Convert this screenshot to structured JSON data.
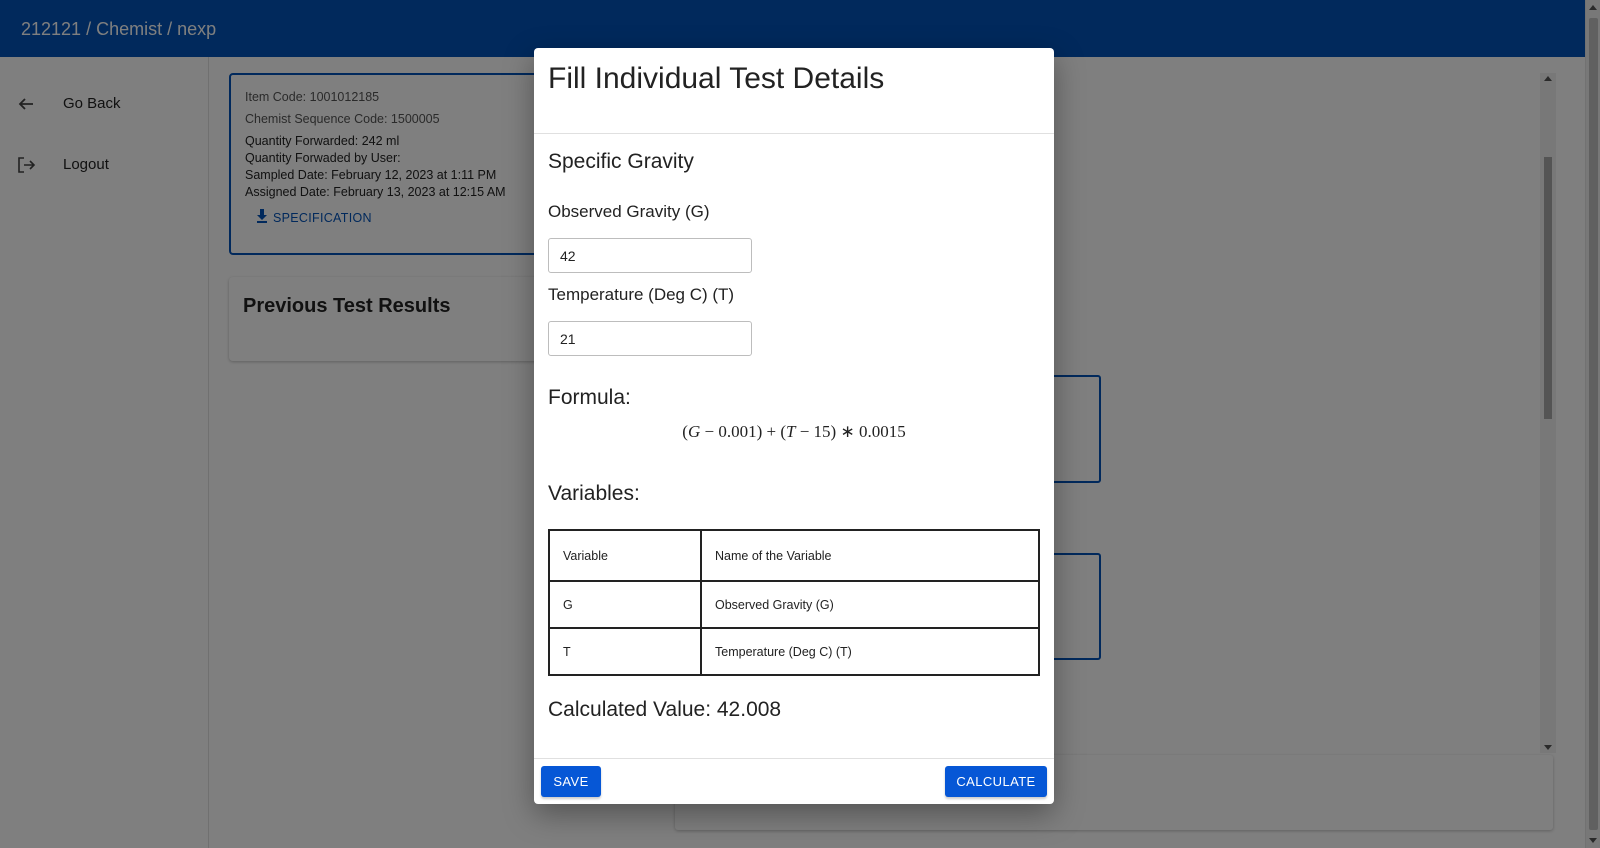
{
  "header": {
    "breadcrumb": "212121 / Chemist / nexp"
  },
  "sidebar": {
    "items": [
      {
        "label": "Go Back",
        "icon": "arrow-left-icon"
      },
      {
        "label": "Logout",
        "icon": "logout-icon"
      }
    ]
  },
  "item_info": {
    "item_code": "Item Code: 1001012185",
    "sequence_code": "Chemist Sequence Code: 1500005",
    "quantity_forwarded": "Quantity Forwarded: 242 ml",
    "forwarded_by": "Quantity Forwaded by User:",
    "sampled_date": "Sampled Date: February 12, 2023 at 1:11 PM",
    "assigned_date": "Assigned Date: February 13, 2023 at 12:15 AM",
    "specification_label": "SPECIFICATION"
  },
  "previous_results": {
    "title": "Previous Test Results"
  },
  "modal": {
    "title": "Fill Individual Test Details",
    "test_name": "Specific Gravity",
    "fields": [
      {
        "label": "Observed Gravity (G)",
        "value": "42"
      },
      {
        "label": "Temperature (Deg C) (T)",
        "value": "21"
      }
    ],
    "formula_label": "Formula:",
    "formula": {
      "open1": "(",
      "var_g": "G",
      "minus1": " − 0.001) + (",
      "var_t": "T",
      "rest": " − 15) ∗ 0.0015"
    },
    "variables_label": "Variables:",
    "table": {
      "headers": [
        "Variable",
        "Name of the Variable"
      ],
      "rows": [
        [
          "G",
          "Observed Gravity (G)"
        ],
        [
          "T",
          "Temperature (Deg C) (T)"
        ]
      ]
    },
    "calculated_value": "Calculated Value: 42.008",
    "save_label": "SAVE",
    "calculate_label": "CALCULATE"
  },
  "colors": {
    "primary": "#0252b8",
    "button": "#0657d6",
    "backdrop": "rgba(0,0,0,0.5)"
  }
}
